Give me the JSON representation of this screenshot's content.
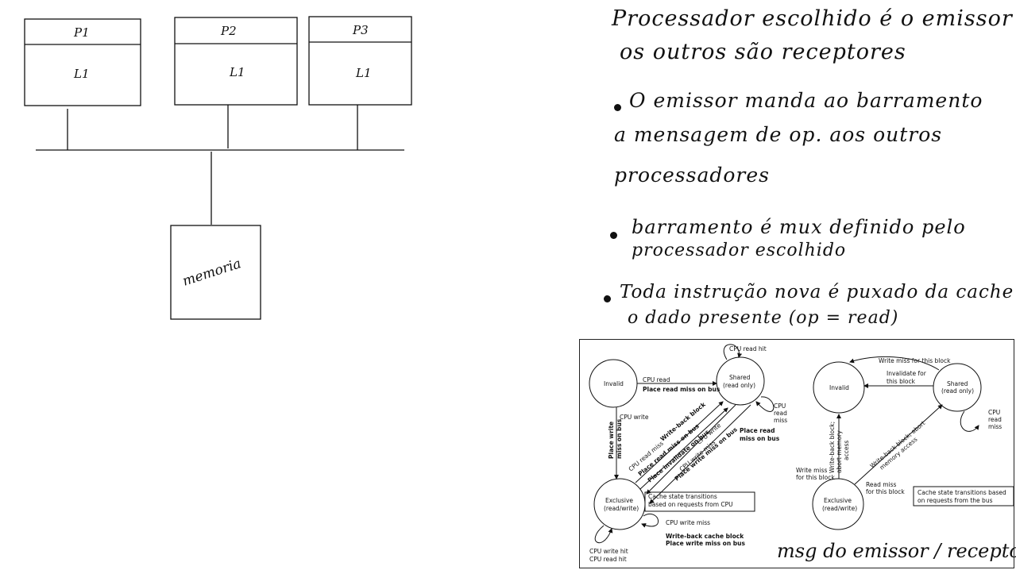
{
  "left_diagram": {
    "processors": [
      {
        "name": "P1",
        "cache": "L1"
      },
      {
        "name": "P2",
        "cache": "L1"
      },
      {
        "name": "P3",
        "cache": "L1"
      }
    ],
    "memory_label": "memoria"
  },
  "notes": {
    "lines": [
      "Processador escolhido é o emissor",
      "os outros são receptores",
      "O emissor manda ao barramento",
      "a mensagem de op. aos outros",
      "processadores",
      "barramento é mux definido pelo",
      "processador escolhido",
      "Toda instrução nova é puxado da cache",
      "o dado presente (op = read)"
    ]
  },
  "state_diagram": {
    "left": {
      "states": [
        "Invalid",
        "Shared\n(read only)",
        "Exclusive\n(read/write)"
      ],
      "labels": {
        "cpu_read_hit": "CPU read hit",
        "cpu_read": "CPU read",
        "place_read_miss": "Place read miss on bus",
        "cpu_write": "CPU write",
        "place_write_miss": "Place write miss on bus",
        "place_write_miss_short": "Place write",
        "miss_on_bus": "miss on bus",
        "cpu_read_miss": "CPU read miss",
        "write_back_block": "Write-back block",
        "place_read_miss_bus": "Place read miss on bus",
        "place_invalidate": "Place invalidate on bus",
        "cpu_write_2": "CPU write",
        "cpu_write_miss": "CPU write miss",
        "place_write_miss_bus": "Place write miss on bus",
        "cpu_read_miss_right_1": "CPU",
        "cpu_read_miss_right_2": "read",
        "cpu_read_miss_right_3": "miss",
        "place_read_1": "Place read",
        "place_read_2": "miss on bus",
        "cpu_write_miss_bottom": "CPU write miss",
        "wb_cache_block": "Write-back cache block",
        "place_write_miss_bottom": "Place write miss on bus",
        "cpu_write_hit": "CPU write hit",
        "cpu_read_hit_bottom": "CPU read hit",
        "box_1": "Cache state transitions",
        "box_2": "based on requests from CPU"
      }
    },
    "right": {
      "states": [
        "Invalid",
        "Shared\n(read only)",
        "Exclusive\n(read/write)"
      ],
      "labels": {
        "write_miss_block": "Write miss for this block",
        "invalidate_1": "Invalidate for",
        "invalidate_2": "this block",
        "cpu_1": "CPU",
        "cpu_2": "read",
        "cpu_3": "miss",
        "write_miss_1": "Write miss",
        "write_miss_2": "for this block",
        "wb_abort_1": "Write-back block;",
        "wb_abort_2": "abort memory",
        "wb_abort_3": "access",
        "wb_abort_diag_1": "Write-back block; abort",
        "wb_abort_diag_2": "memory access",
        "read_miss_1": "Read miss",
        "read_miss_2": "for this block",
        "box_1": "Cache state transitions based",
        "box_2": "on requests from the bus"
      }
    }
  },
  "caption": "msg do emissor / receptor"
}
